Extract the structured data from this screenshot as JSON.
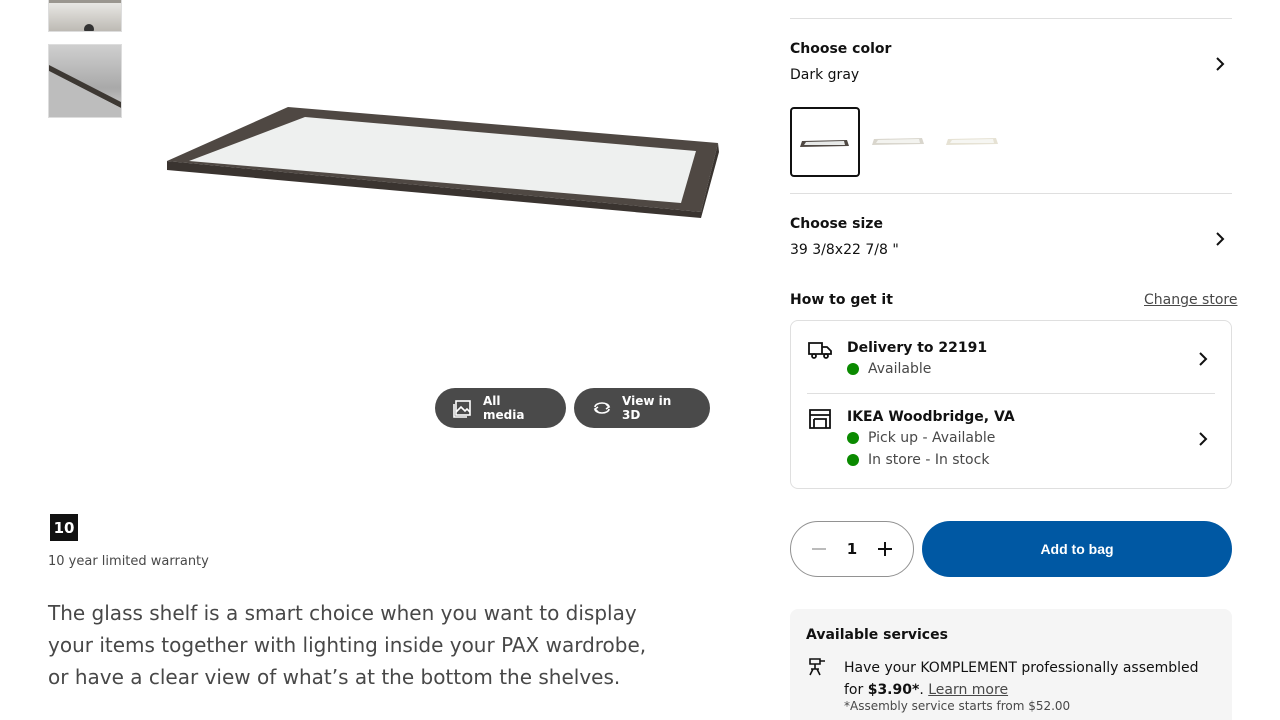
{
  "gallery": {
    "all_media_label": "All media",
    "view3d_label": "View in 3D"
  },
  "warranty": {
    "years": "10",
    "text": "10 year limited warranty"
  },
  "description": "The glass shelf is a smart choice when you want to display your items together with lighting inside your PAX wardrobe, or have a clear view of what’s at the bottom the shelves.",
  "color": {
    "heading": "Choose color",
    "selected": "Dark gray",
    "swatch_count": 3
  },
  "size": {
    "heading": "Choose size",
    "selected": "39 3/8x22 7/8 \""
  },
  "availability": {
    "heading": "How to get it",
    "change_store": "Change store",
    "delivery_title": "Delivery to 22191",
    "delivery_status": "Available",
    "store_title": "IKEA Woodbridge, VA",
    "pickup_status": "Pick up - Available",
    "instore_status": "In store - In stock",
    "status_color": "#0a8a00"
  },
  "purchase": {
    "quantity": "1",
    "add_to_bag": "Add to bag",
    "button_color": "#0058a3"
  },
  "services": {
    "heading": "Available services",
    "text_before": "Have your KOMPLEMENT professionally assembled for ",
    "price": "$3.90*",
    "text_after": ". ",
    "learn_more": "Learn more",
    "note": "*Assembly service starts from $52.00"
  }
}
